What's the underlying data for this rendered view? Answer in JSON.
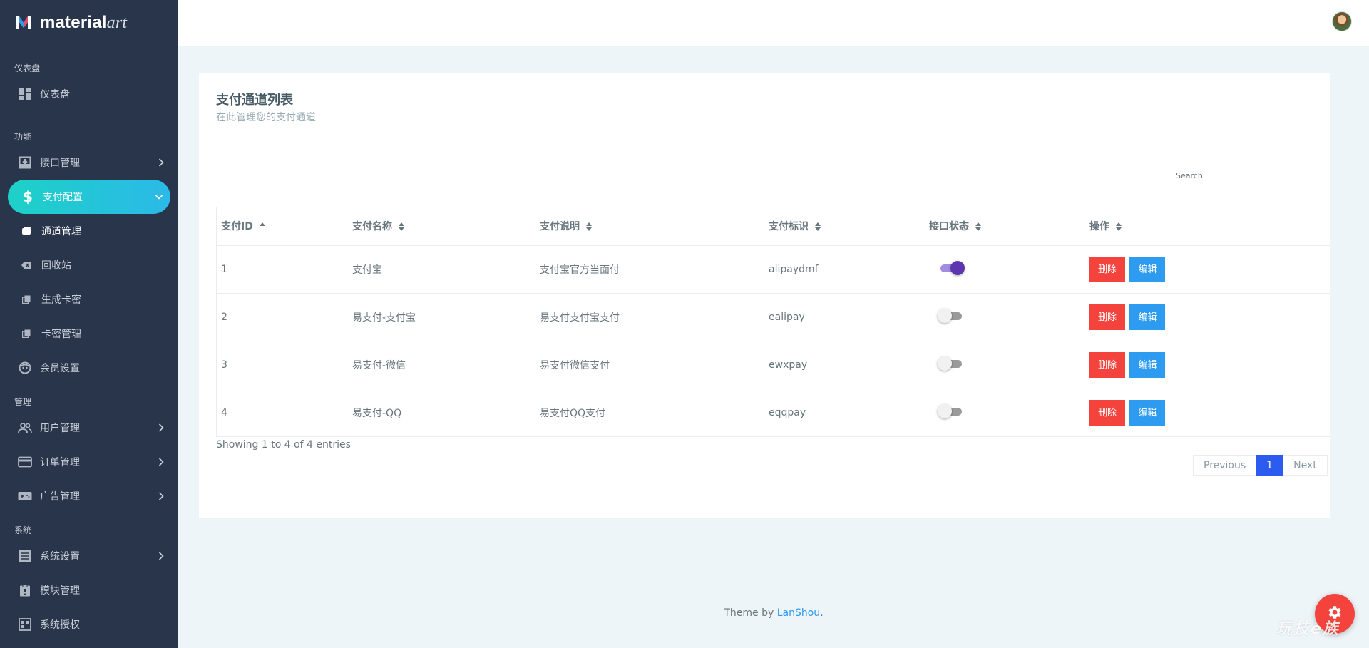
{
  "brand": {
    "name_bold": "material",
    "name_script": "art"
  },
  "sidebar": {
    "sections": [
      {
        "caption": "仪表盘"
      },
      {
        "caption": "功能"
      },
      {
        "caption": "管理"
      },
      {
        "caption": "系统"
      }
    ],
    "items": {
      "dashboard": "仪表盘",
      "api": "接口管理",
      "payment": "支付配置",
      "channel": "通道管理",
      "recycle": "回收站",
      "gen_card": "生成卡密",
      "card_manage": "卡密管理",
      "member": "会员设置",
      "users": "用户管理",
      "orders": "订单管理",
      "ads": "广告管理",
      "sys_settings": "系统设置",
      "modules": "模块管理",
      "auth": "系统授权"
    }
  },
  "card": {
    "title": "支付通道列表",
    "subtitle": "在此管理您的支付通道",
    "search_label": "Search:",
    "search_value": "",
    "columns": [
      "支付ID",
      "支付名称",
      "支付说明",
      "支付标识",
      "接口状态",
      "操作"
    ],
    "rows": [
      {
        "id": "1",
        "name": "支付宝",
        "desc": "支付宝官方当面付",
        "code": "alipaydmf",
        "enabled": true
      },
      {
        "id": "2",
        "name": "易支付-支付宝",
        "desc": "易支付支付宝支付",
        "code": "ealipay",
        "enabled": false
      },
      {
        "id": "3",
        "name": "易支付-微信",
        "desc": "易支付微信支付",
        "code": "ewxpay",
        "enabled": false
      },
      {
        "id": "4",
        "name": "易支付-QQ",
        "desc": "易支付QQ支付",
        "code": "eqqpay",
        "enabled": false
      }
    ],
    "actions": {
      "delete": "删除",
      "edit": "编辑"
    },
    "info": "Showing 1 to 4 of 4 entries",
    "pager": {
      "prev": "Previous",
      "current": "1",
      "next": "Next"
    }
  },
  "footer": {
    "prefix": "Theme by ",
    "link": "LanShou",
    "suffix": "."
  },
  "watermark": "玩技e族",
  "colors": {
    "sidebar": "#28354b",
    "active_start": "#1dd1c7",
    "active_end": "#2bb9e8",
    "danger": "#f4433d",
    "info": "#2d9bf0",
    "primary": "#2b5bef",
    "switch_on": "#5e35b1"
  }
}
